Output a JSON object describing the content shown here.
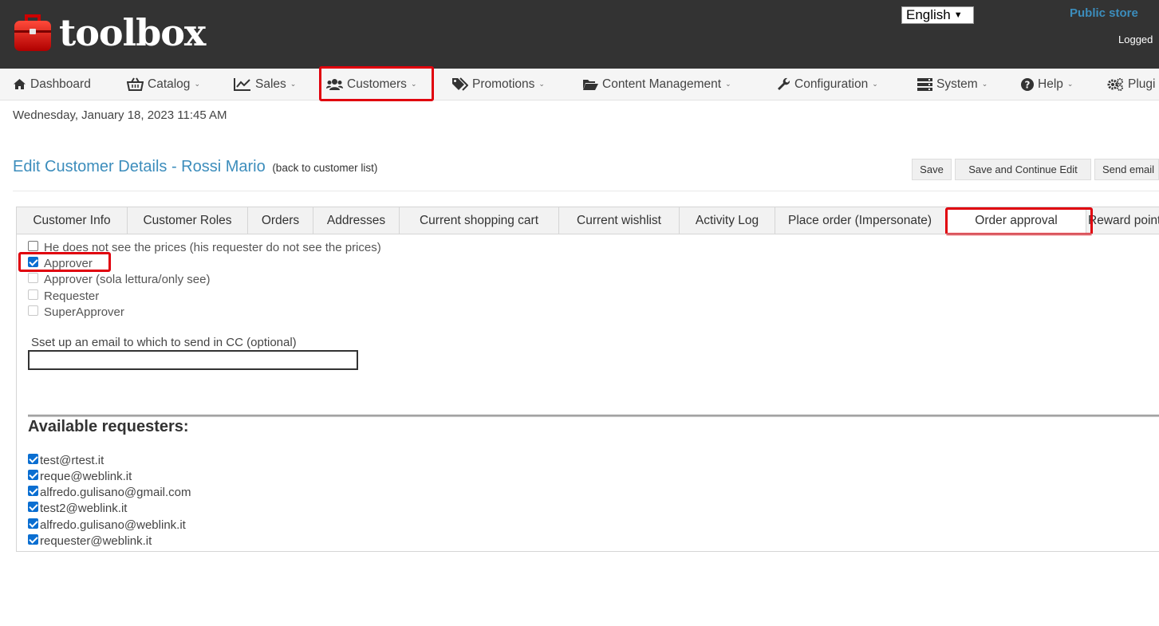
{
  "header": {
    "logo_text": "toolbox",
    "language": "English",
    "public_store": "Public store",
    "separator": "|",
    "logged": "Logged"
  },
  "nav": {
    "items": [
      {
        "label": "Dashboard",
        "icon": "home-icon"
      },
      {
        "label": "Catalog",
        "icon": "basket-icon"
      },
      {
        "label": "Sales",
        "icon": "line-chart-icon"
      },
      {
        "label": "Customers",
        "icon": "users-icon"
      },
      {
        "label": "Promotions",
        "icon": "tags-icon"
      },
      {
        "label": "Content Management",
        "icon": "folder-open-icon"
      },
      {
        "label": "Configuration",
        "icon": "wrench-icon"
      },
      {
        "label": "System",
        "icon": "server-icon"
      },
      {
        "label": "Help",
        "icon": "question-circle-icon"
      },
      {
        "label": "Plugi",
        "icon": "gears-icon"
      }
    ]
  },
  "date_text": "Wednesday, January 18, 2023 11:45 AM",
  "page": {
    "title": "Edit Customer Details - Rossi Mario",
    "back_link": "(back to customer list)",
    "buttons": {
      "save": "Save",
      "save_continue": "Save and Continue Edit",
      "send_email": "Send email"
    }
  },
  "tabs": [
    {
      "label": "Customer Info"
    },
    {
      "label": "Customer Roles"
    },
    {
      "label": "Orders"
    },
    {
      "label": "Addresses"
    },
    {
      "label": "Current shopping cart"
    },
    {
      "label": "Current wishlist"
    },
    {
      "label": "Activity Log"
    },
    {
      "label": "Place order (Impersonate)"
    },
    {
      "label": "Order approval"
    },
    {
      "label": "Reward points"
    }
  ],
  "options": [
    {
      "label": "He does not see the prices (his requester do not see the prices)",
      "checked": false
    },
    {
      "label": "Approver",
      "checked": true
    },
    {
      "label": "Approver (sola lettura/only see)",
      "checked": false
    },
    {
      "label": "Requester",
      "checked": false
    },
    {
      "label": "SuperApprover",
      "checked": false
    }
  ],
  "cc": {
    "label": "Sset up an email to which to send in CC (optional)",
    "value": ""
  },
  "requesters": {
    "title": "Available requesters:",
    "items": [
      {
        "email": "test@rtest.it",
        "checked": true
      },
      {
        "email": "reque@weblink.it",
        "checked": true
      },
      {
        "email": "alfredo.gulisano@gmail.com",
        "checked": true
      },
      {
        "email": "test2@weblink.it",
        "checked": true
      },
      {
        "email": "alfredo.gulisano@weblink.it",
        "checked": true
      },
      {
        "email": "requester@weblink.it",
        "checked": true
      }
    ]
  },
  "colors": {
    "header_bg": "#333333",
    "accent": "#3c8dbc",
    "highlight": "#e0000d"
  }
}
